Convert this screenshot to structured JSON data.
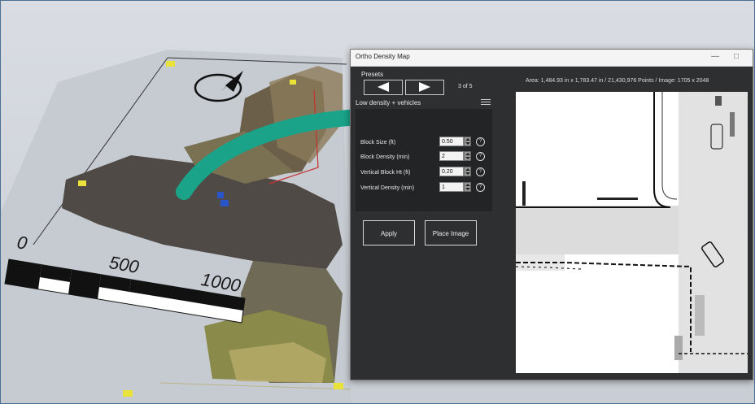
{
  "scene": {
    "scale_labels": [
      "0",
      "500",
      "1000"
    ],
    "accent_arrow_color": "#1aa389",
    "ground_plane_color": "#c8cdd3"
  },
  "dialog": {
    "title": "Ortho Density Map",
    "window_controls": [
      "minimize-icon",
      "maximize-icon"
    ],
    "presets_label": "Presets",
    "preset_counter": "3 of 5",
    "preset_name": "Low density + vehicles",
    "parameters": [
      {
        "label": "Block Size (ft)",
        "value": "0.50"
      },
      {
        "label": "Block Density (min)",
        "value": "2"
      },
      {
        "label": "Vertical Block Ht (ft)",
        "value": "0.20"
      },
      {
        "label": "Vertical Density (min)",
        "value": "1"
      }
    ],
    "help_glyph": "?",
    "apply_label": "Apply",
    "place_image_label": "Place Image",
    "info_text": "Area: 1,484.93 in x 1,783.47  in / 21,430,976 Points / Image: 1705 x 2048"
  }
}
